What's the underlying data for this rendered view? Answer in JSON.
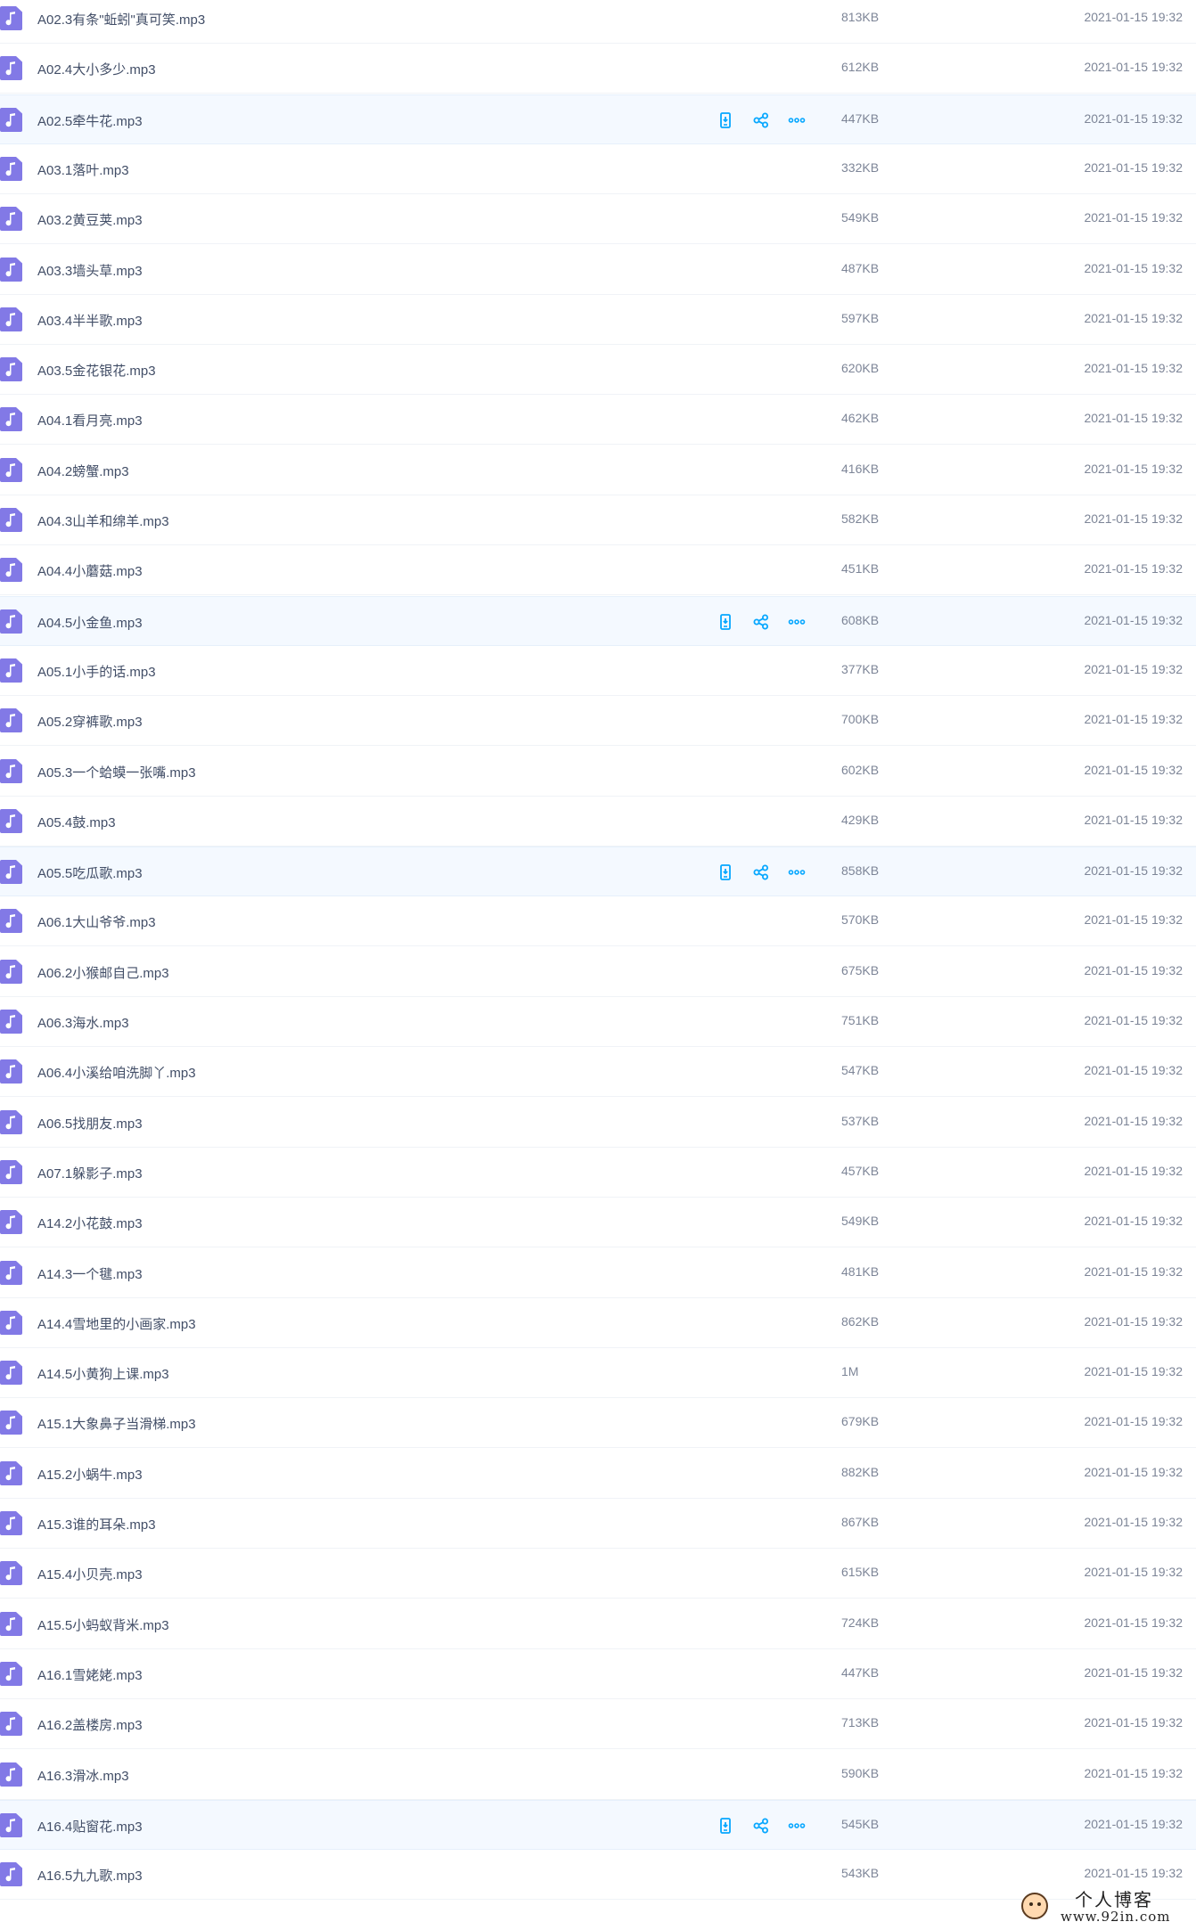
{
  "files": [
    {
      "name": "A02.3有条\"蚯蚓\"真可笑.mp3",
      "size": "813KB",
      "time": "2021-01-15 19:32",
      "hover": false
    },
    {
      "name": "A02.4大小多少.mp3",
      "size": "612KB",
      "time": "2021-01-15 19:32",
      "hover": false
    },
    {
      "name": "A02.5牵牛花.mp3",
      "size": "447KB",
      "time": "2021-01-15 19:32",
      "hover": true
    },
    {
      "name": "A03.1落叶.mp3",
      "size": "332KB",
      "time": "2021-01-15 19:32",
      "hover": false
    },
    {
      "name": "A03.2黄豆荚.mp3",
      "size": "549KB",
      "time": "2021-01-15 19:32",
      "hover": false
    },
    {
      "name": "A03.3墙头草.mp3",
      "size": "487KB",
      "time": "2021-01-15 19:32",
      "hover": false
    },
    {
      "name": "A03.4半半歌.mp3",
      "size": "597KB",
      "time": "2021-01-15 19:32",
      "hover": false
    },
    {
      "name": "A03.5金花银花.mp3",
      "size": "620KB",
      "time": "2021-01-15 19:32",
      "hover": false
    },
    {
      "name": "A04.1看月亮.mp3",
      "size": "462KB",
      "time": "2021-01-15 19:32",
      "hover": false
    },
    {
      "name": "A04.2螃蟹.mp3",
      "size": "416KB",
      "time": "2021-01-15 19:32",
      "hover": false
    },
    {
      "name": "A04.3山羊和绵羊.mp3",
      "size": "582KB",
      "time": "2021-01-15 19:32",
      "hover": false
    },
    {
      "name": "A04.4小蘑菇.mp3",
      "size": "451KB",
      "time": "2021-01-15 19:32",
      "hover": false
    },
    {
      "name": "A04.5小金鱼.mp3",
      "size": "608KB",
      "time": "2021-01-15 19:32",
      "hover": true
    },
    {
      "name": "A05.1小手的话.mp3",
      "size": "377KB",
      "time": "2021-01-15 19:32",
      "hover": false
    },
    {
      "name": "A05.2穿裤歌.mp3",
      "size": "700KB",
      "time": "2021-01-15 19:32",
      "hover": false
    },
    {
      "name": "A05.3一个蛤蟆一张嘴.mp3",
      "size": "602KB",
      "time": "2021-01-15 19:32",
      "hover": false
    },
    {
      "name": "A05.4鼓.mp3",
      "size": "429KB",
      "time": "2021-01-15 19:32",
      "hover": false
    },
    {
      "name": "A05.5吃瓜歌.mp3",
      "size": "858KB",
      "time": "2021-01-15 19:32",
      "hover": true
    },
    {
      "name": "A06.1大山爷爷.mp3",
      "size": "570KB",
      "time": "2021-01-15 19:32",
      "hover": false
    },
    {
      "name": "A06.2小猴邮自己.mp3",
      "size": "675KB",
      "time": "2021-01-15 19:32",
      "hover": false
    },
    {
      "name": "A06.3海水.mp3",
      "size": "751KB",
      "time": "2021-01-15 19:32",
      "hover": false
    },
    {
      "name": "A06.4小溪给咱洗脚丫.mp3",
      "size": "547KB",
      "time": "2021-01-15 19:32",
      "hover": false
    },
    {
      "name": "A06.5找朋友.mp3",
      "size": "537KB",
      "time": "2021-01-15 19:32",
      "hover": false
    },
    {
      "name": "A07.1躲影子.mp3",
      "size": "457KB",
      "time": "2021-01-15 19:32",
      "hover": false
    },
    {
      "name": "A14.2小花鼓.mp3",
      "size": "549KB",
      "time": "2021-01-15 19:32",
      "hover": false
    },
    {
      "name": "A14.3一个毽.mp3",
      "size": "481KB",
      "time": "2021-01-15 19:32",
      "hover": false
    },
    {
      "name": "A14.4雪地里的小画家.mp3",
      "size": "862KB",
      "time": "2021-01-15 19:32",
      "hover": false
    },
    {
      "name": "A14.5小黄狗上课.mp3",
      "size": "1M",
      "time": "2021-01-15 19:32",
      "hover": false
    },
    {
      "name": "A15.1大象鼻子当滑梯.mp3",
      "size": "679KB",
      "time": "2021-01-15 19:32",
      "hover": false
    },
    {
      "name": "A15.2小蜗牛.mp3",
      "size": "882KB",
      "time": "2021-01-15 19:32",
      "hover": false
    },
    {
      "name": "A15.3谁的耳朵.mp3",
      "size": "867KB",
      "time": "2021-01-15 19:32",
      "hover": false
    },
    {
      "name": "A15.4小贝壳.mp3",
      "size": "615KB",
      "time": "2021-01-15 19:32",
      "hover": false
    },
    {
      "name": "A15.5小蚂蚁背米.mp3",
      "size": "724KB",
      "time": "2021-01-15 19:32",
      "hover": false
    },
    {
      "name": "A16.1雪姥姥.mp3",
      "size": "447KB",
      "time": "2021-01-15 19:32",
      "hover": false
    },
    {
      "name": "A16.2盖楼房.mp3",
      "size": "713KB",
      "time": "2021-01-15 19:32",
      "hover": false
    },
    {
      "name": "A16.3滑冰.mp3",
      "size": "590KB",
      "time": "2021-01-15 19:32",
      "hover": false
    },
    {
      "name": "A16.4贴窗花.mp3",
      "size": "545KB",
      "time": "2021-01-15 19:32",
      "hover": true
    },
    {
      "name": "A16.5九九歌.mp3",
      "size": "543KB",
      "time": "2021-01-15 19:32",
      "hover": false
    }
  ],
  "icons": {
    "file": "music-file-icon",
    "action_1": "phone-save-icon",
    "action_2": "share-icon",
    "action_3": "more-icon"
  },
  "colors": {
    "file_icon": "#8279e6",
    "action_icon": "#06a7ff",
    "row_hover": "#f4f9ff"
  },
  "watermark": {
    "title": "个人博客",
    "url": "www.92in.com"
  }
}
